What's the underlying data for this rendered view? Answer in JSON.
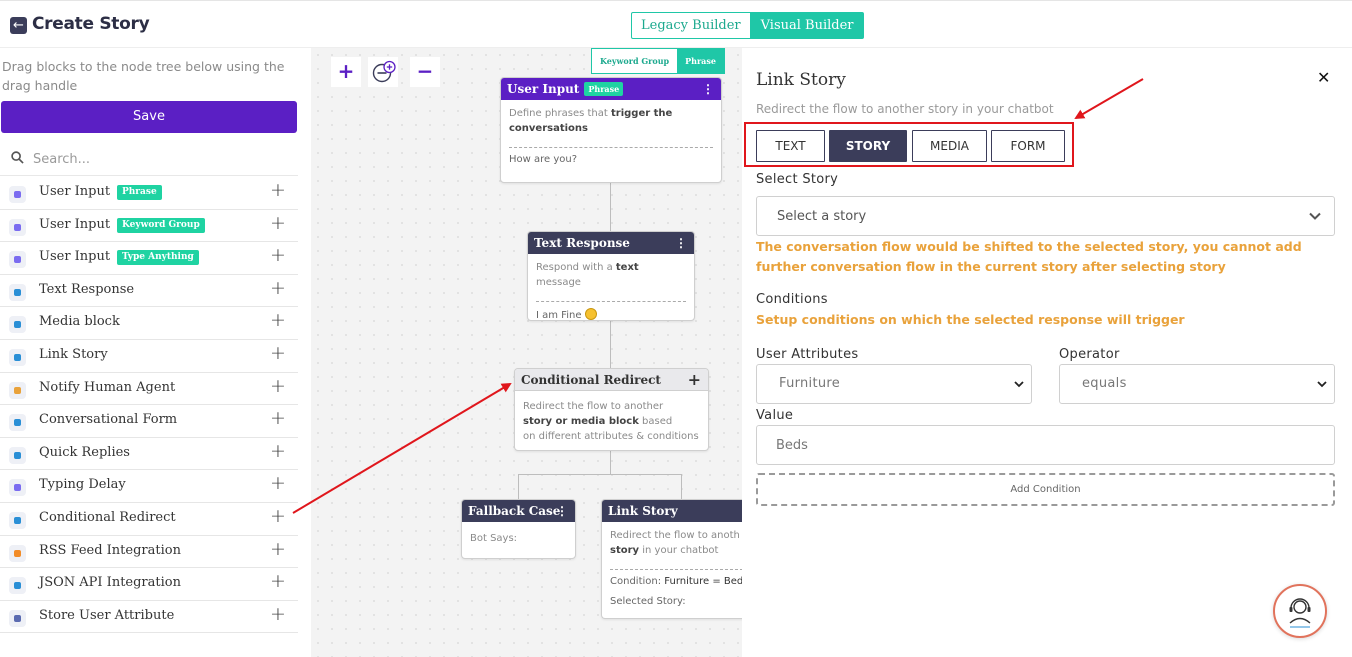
{
  "header": {
    "back_icon": "arrow-left-icon",
    "title": "Create Story",
    "builder_tabs": [
      "Legacy Builder",
      "Visual Builder"
    ]
  },
  "sidebar": {
    "hint": "Drag blocks to the node tree below using the drag handle",
    "save_label": "Save",
    "search_placeholder": "Search...",
    "blocks": [
      {
        "label": "User Input",
        "tag": "Phrase",
        "color": "#7b6cf0"
      },
      {
        "label": "User Input",
        "tag": "Keyword Group",
        "color": "#7b6cf0"
      },
      {
        "label": "User Input",
        "tag": "Type Anything",
        "color": "#7b6cf0"
      },
      {
        "label": "Text Response",
        "tag": "",
        "color": "#2a8fd6"
      },
      {
        "label": "Media block",
        "tag": "",
        "color": "#2a8fd6"
      },
      {
        "label": "Link Story",
        "tag": "",
        "color": "#2a8fd6"
      },
      {
        "label": "Notify Human Agent",
        "tag": "",
        "color": "#e9a23b"
      },
      {
        "label": "Conversational Form",
        "tag": "",
        "color": "#2a8fd6"
      },
      {
        "label": "Quick Replies",
        "tag": "",
        "color": "#2a8fd6"
      },
      {
        "label": "Typing Delay",
        "tag": "",
        "color": "#7b6cf0"
      },
      {
        "label": "Conditional Redirect",
        "tag": "",
        "color": "#2a8fd6"
      },
      {
        "label": "RSS Feed Integration",
        "tag": "",
        "color": "#f28c28"
      },
      {
        "label": "JSON API Integration",
        "tag": "",
        "color": "#2a8fd6"
      },
      {
        "label": "Store User Attribute",
        "tag": "",
        "color": "#5b6bb0"
      }
    ]
  },
  "canvas": {
    "zoom_in": "+",
    "zoom_out": "−",
    "phrase_toggle": [
      "Keyword Group",
      "Phrase"
    ],
    "nodes": {
      "user_input": {
        "title": "User Input",
        "tag": "Phrase",
        "desc_pre": "Define phrases that ",
        "desc_bold": "trigger the conversations",
        "example": "How are you?"
      },
      "text_response": {
        "title": "Text Response",
        "desc_pre": "Respond with a ",
        "desc_bold": "text",
        "desc_post": " message",
        "example": "I am Fine"
      },
      "conditional_redirect": {
        "title": "Conditional Redirect",
        "line1": "Redirect the flow to another",
        "line2_bold": "story or media block",
        "line2_post": " based",
        "line3": "on different attributes & conditions"
      },
      "fallback": {
        "title": "Fallback Case",
        "body": "Bot Says:"
      },
      "link_story": {
        "title": "Link Story",
        "line1": "Redirect the flow to anoth",
        "line2_bold": "story",
        "line2_post": " in your chatbot",
        "cond_pre": "Condition: ",
        "cond_bold": "Furniture = Bed",
        "selected": "Selected Story:"
      }
    }
  },
  "panel": {
    "title": "Link Story",
    "subtitle": "Redirect the flow to another story in your chatbot",
    "tabs": [
      "TEXT",
      "STORY",
      "MEDIA",
      "FORM"
    ],
    "active_tab": "STORY",
    "select_story_label": "Select Story",
    "select_story_placeholder": "Select a story",
    "warning": "The conversation flow would be shifted to the selected story, you cannot add further conversation flow in the current story after selecting story",
    "conditions_label": "Conditions",
    "conditions_help": "Setup conditions on which the selected response will trigger",
    "user_attributes_label": "User Attributes",
    "user_attributes_value": "Furniture",
    "operator_label": "Operator",
    "operator_value": "equals",
    "value_label": "Value",
    "value_value": "Beds",
    "add_condition": "Add Condition"
  },
  "colors": {
    "accent_purple": "#5b1fc4",
    "teal": "#1fc7a7",
    "dark_header": "#3b3d5a",
    "warning_orange": "#e9a23b",
    "annotation_red": "#e0161c"
  }
}
